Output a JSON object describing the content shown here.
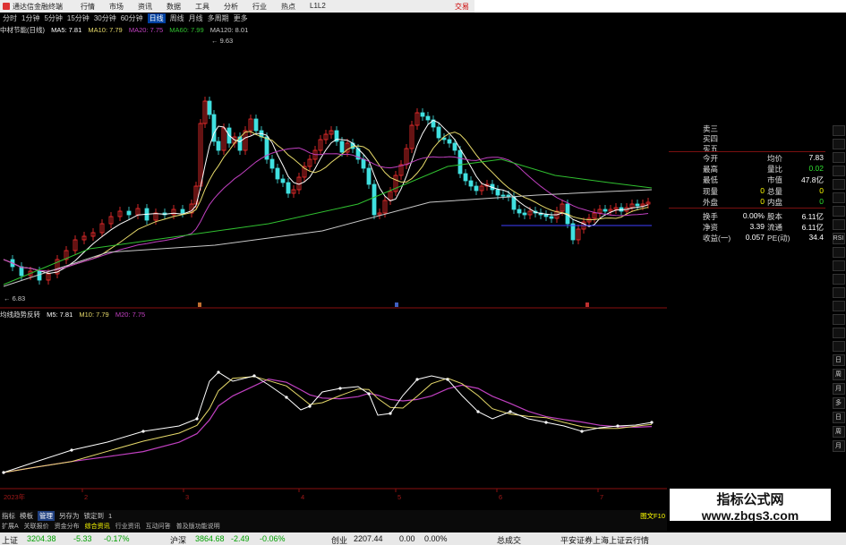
{
  "app": {
    "title": "通达信金融终端",
    "menu": [
      "行情",
      "市场",
      "资讯",
      "数据",
      "工具",
      "分析",
      "行业",
      "热点",
      "L1L2"
    ],
    "trade": "交易"
  },
  "periods": [
    "分时",
    "1分钟",
    "5分钟",
    "15分钟",
    "30分钟",
    "60分钟",
    "日线",
    "周线",
    "月线",
    "多周期",
    "更多"
  ],
  "active_period": "日线",
  "kline": {
    "name": "中材节能(日线)",
    "ma": [
      {
        "label": "MA5: 7.81",
        "color": "#ffffff"
      },
      {
        "label": "MA10: 7.79",
        "color": "#e6d96a"
      },
      {
        "label": "MA20: 7.75",
        "color": "#c040c0"
      },
      {
        "label": "MA60: 7.99",
        "color": "#30c030"
      },
      {
        "label": "MA120: 8.01",
        "color": "#c8c8c8"
      }
    ],
    "high_label": "9.63",
    "low_label": "6.83",
    "y_ticks": [
      "8.60",
      "8.40",
      "8.20",
      "8.00",
      "7.80",
      "7.60",
      "7.40",
      "7.20",
      "7.00",
      "6.80"
    ]
  },
  "indicator": {
    "name": "均线趋势反转",
    "lines": [
      {
        "label": "M5: 7.81",
        "color": "#ffffff"
      },
      {
        "label": "M10: 7.79",
        "color": "#e6d96a"
      },
      {
        "label": "M20: 7.75",
        "color": "#c040c0"
      }
    ],
    "y_ticks": [
      "9.50",
      "9.00",
      "8.50",
      "8.00",
      "7.50",
      "7.00"
    ]
  },
  "x_axis": {
    "year_label": "2023年",
    "months": [
      "2",
      "3",
      "4",
      "5",
      "6",
      "7"
    ]
  },
  "quote": {
    "depth": [
      "卖三",
      "买四",
      "买五"
    ],
    "rows": [
      {
        "l1": "今开",
        "v1": "",
        "l2": "均价",
        "v2": "7.83",
        "c2": "#ffffff"
      },
      {
        "l1": "最高",
        "v1": "",
        "l2": "量比",
        "v2": "0.02",
        "c2": "#30e030"
      },
      {
        "l1": "最低",
        "v1": "",
        "l2": "市值",
        "v2": "47.8亿",
        "c2": "#ffffff"
      },
      {
        "l1": "现量",
        "v1": "0",
        "l2": "总量",
        "v2": "0",
        "c2": "#ffff00"
      },
      {
        "l1": "外盘",
        "v1": "0",
        "l2": "内盘",
        "v2": "0",
        "c2": "#30e030"
      },
      {
        "l1": "换手",
        "v1": "0.00%",
        "l2": "股本",
        "v2": "6.11亿",
        "c2": "#ffffff"
      },
      {
        "l1": "净资",
        "v1": "3.39",
        "l2": "流通",
        "v2": "6.11亿",
        "c2": "#ffffff"
      },
      {
        "l1": "收益(一)",
        "v1": "0.057",
        "l2": "PE(动)",
        "v2": "34.4",
        "c2": "#ffffff"
      }
    ]
  },
  "sidebar": [
    "",
    "",
    "",
    "",
    "",
    "",
    "",
    "",
    "RSI",
    "",
    "",
    "",
    "",
    "",
    "",
    "",
    "",
    "日",
    "周",
    "月",
    "多",
    "日",
    "周",
    "月"
  ],
  "tabs": [
    "指标",
    "模板",
    "管理",
    "另存为",
    "锁定到",
    "1"
  ],
  "active_tab": "管理",
  "links": [
    "扩展A",
    "关联报价",
    "资金分布",
    "综合资讯",
    "行业资讯",
    "互动问答",
    "普及版功能说明"
  ],
  "active_link": "综合资讯",
  "f10": "图文F10",
  "watermark": {
    "line1": "指标公式网",
    "line2": "www.zbgs3.com"
  },
  "status": {
    "sh_name": "上证",
    "sh_val": "3204.38",
    "sh_chg": "-5.33",
    "sh_pct": "-0.17%",
    "hs_name": "沪深",
    "hs_val": "3864.68",
    "hs_chg": "-2.49",
    "hs_pct": "-0.06%",
    "cy_name": "创业",
    "cy_val": "2207.44",
    "cy_chg": "0.00",
    "cy_pct": "0.00%",
    "total_label": "总成交",
    "broker": "平安证券上海上证云行情"
  }
}
